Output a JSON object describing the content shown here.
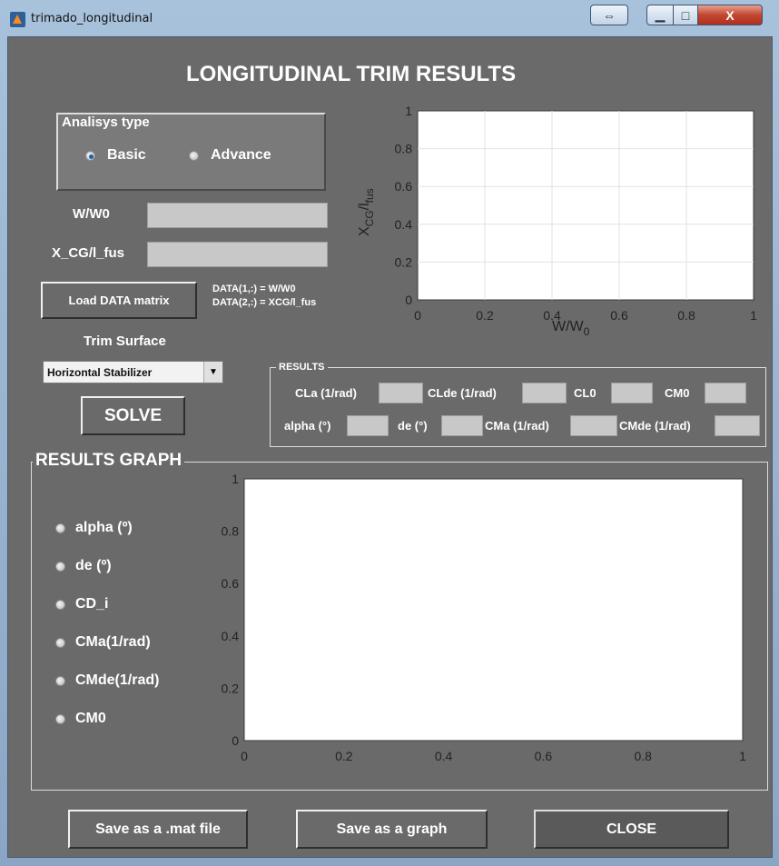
{
  "window": {
    "title": "trimado_longitudinal",
    "resize_glyph": "⇔",
    "min_glyph": "▁",
    "max_glyph": "□",
    "close_glyph": "X"
  },
  "header": {
    "title": "LONGITUDINAL TRIM RESULTS"
  },
  "analysis": {
    "legend": "Analisys type",
    "options": [
      "Basic",
      "Advance"
    ],
    "selected": "Basic"
  },
  "inputs": {
    "w_label": "W/W0",
    "w_value": "",
    "xcg_label": "X_CG/l_fus",
    "xcg_value": ""
  },
  "load": {
    "button": "Load DATA matrix",
    "hint1": "DATA(1,:) = W/W0",
    "hint2": "DATA(2,:) = XCG/l_fus"
  },
  "trim": {
    "label": "Trim Surface",
    "selected": "Horizontal Stabilizer"
  },
  "solve": {
    "label": "SOLVE"
  },
  "results": {
    "legend": "RESULTS",
    "row1": [
      "CLa (1/rad)",
      "CLde (1/rad)",
      "CL0",
      "CM0"
    ],
    "row2": [
      "alpha (°)",
      "de (°)",
      "CMa (1/rad)",
      "CMde (1/rad)"
    ]
  },
  "graph": {
    "legend": "RESULTS GRAPH",
    "options": [
      "alpha (º)",
      "de (º)",
      "CD_i",
      "CMa(1/rad)",
      "CMde(1/rad)",
      "CM0"
    ]
  },
  "footer": {
    "save_mat": "Save as a .mat file",
    "save_graph": "Save as a graph",
    "close": "CLOSE"
  },
  "colors": {
    "panel": "#6a6a6a",
    "field": "#c8c8c8",
    "radio_dot": "#1f5fa8"
  },
  "chart_data": [
    {
      "type": "line",
      "xlabel": "W/W0",
      "ylabel": "X_CG/l_fus",
      "xlim": [
        0,
        1
      ],
      "ylim": [
        0,
        1
      ],
      "grid": true,
      "xticks": [
        "0",
        "0.2",
        "0.4",
        "0.6",
        "0.8",
        "1"
      ],
      "yticks": [
        "0",
        "0.2",
        "0.4",
        "0.6",
        "0.8",
        "1"
      ],
      "series": []
    },
    {
      "type": "line",
      "xlim": [
        0,
        1
      ],
      "ylim": [
        0,
        1
      ],
      "grid": false,
      "xticks": [
        "0",
        "0.2",
        "0.4",
        "0.6",
        "0.8",
        "1"
      ],
      "yticks": [
        "0",
        "0.2",
        "0.4",
        "0.6",
        "0.8",
        "1"
      ],
      "series": []
    }
  ]
}
